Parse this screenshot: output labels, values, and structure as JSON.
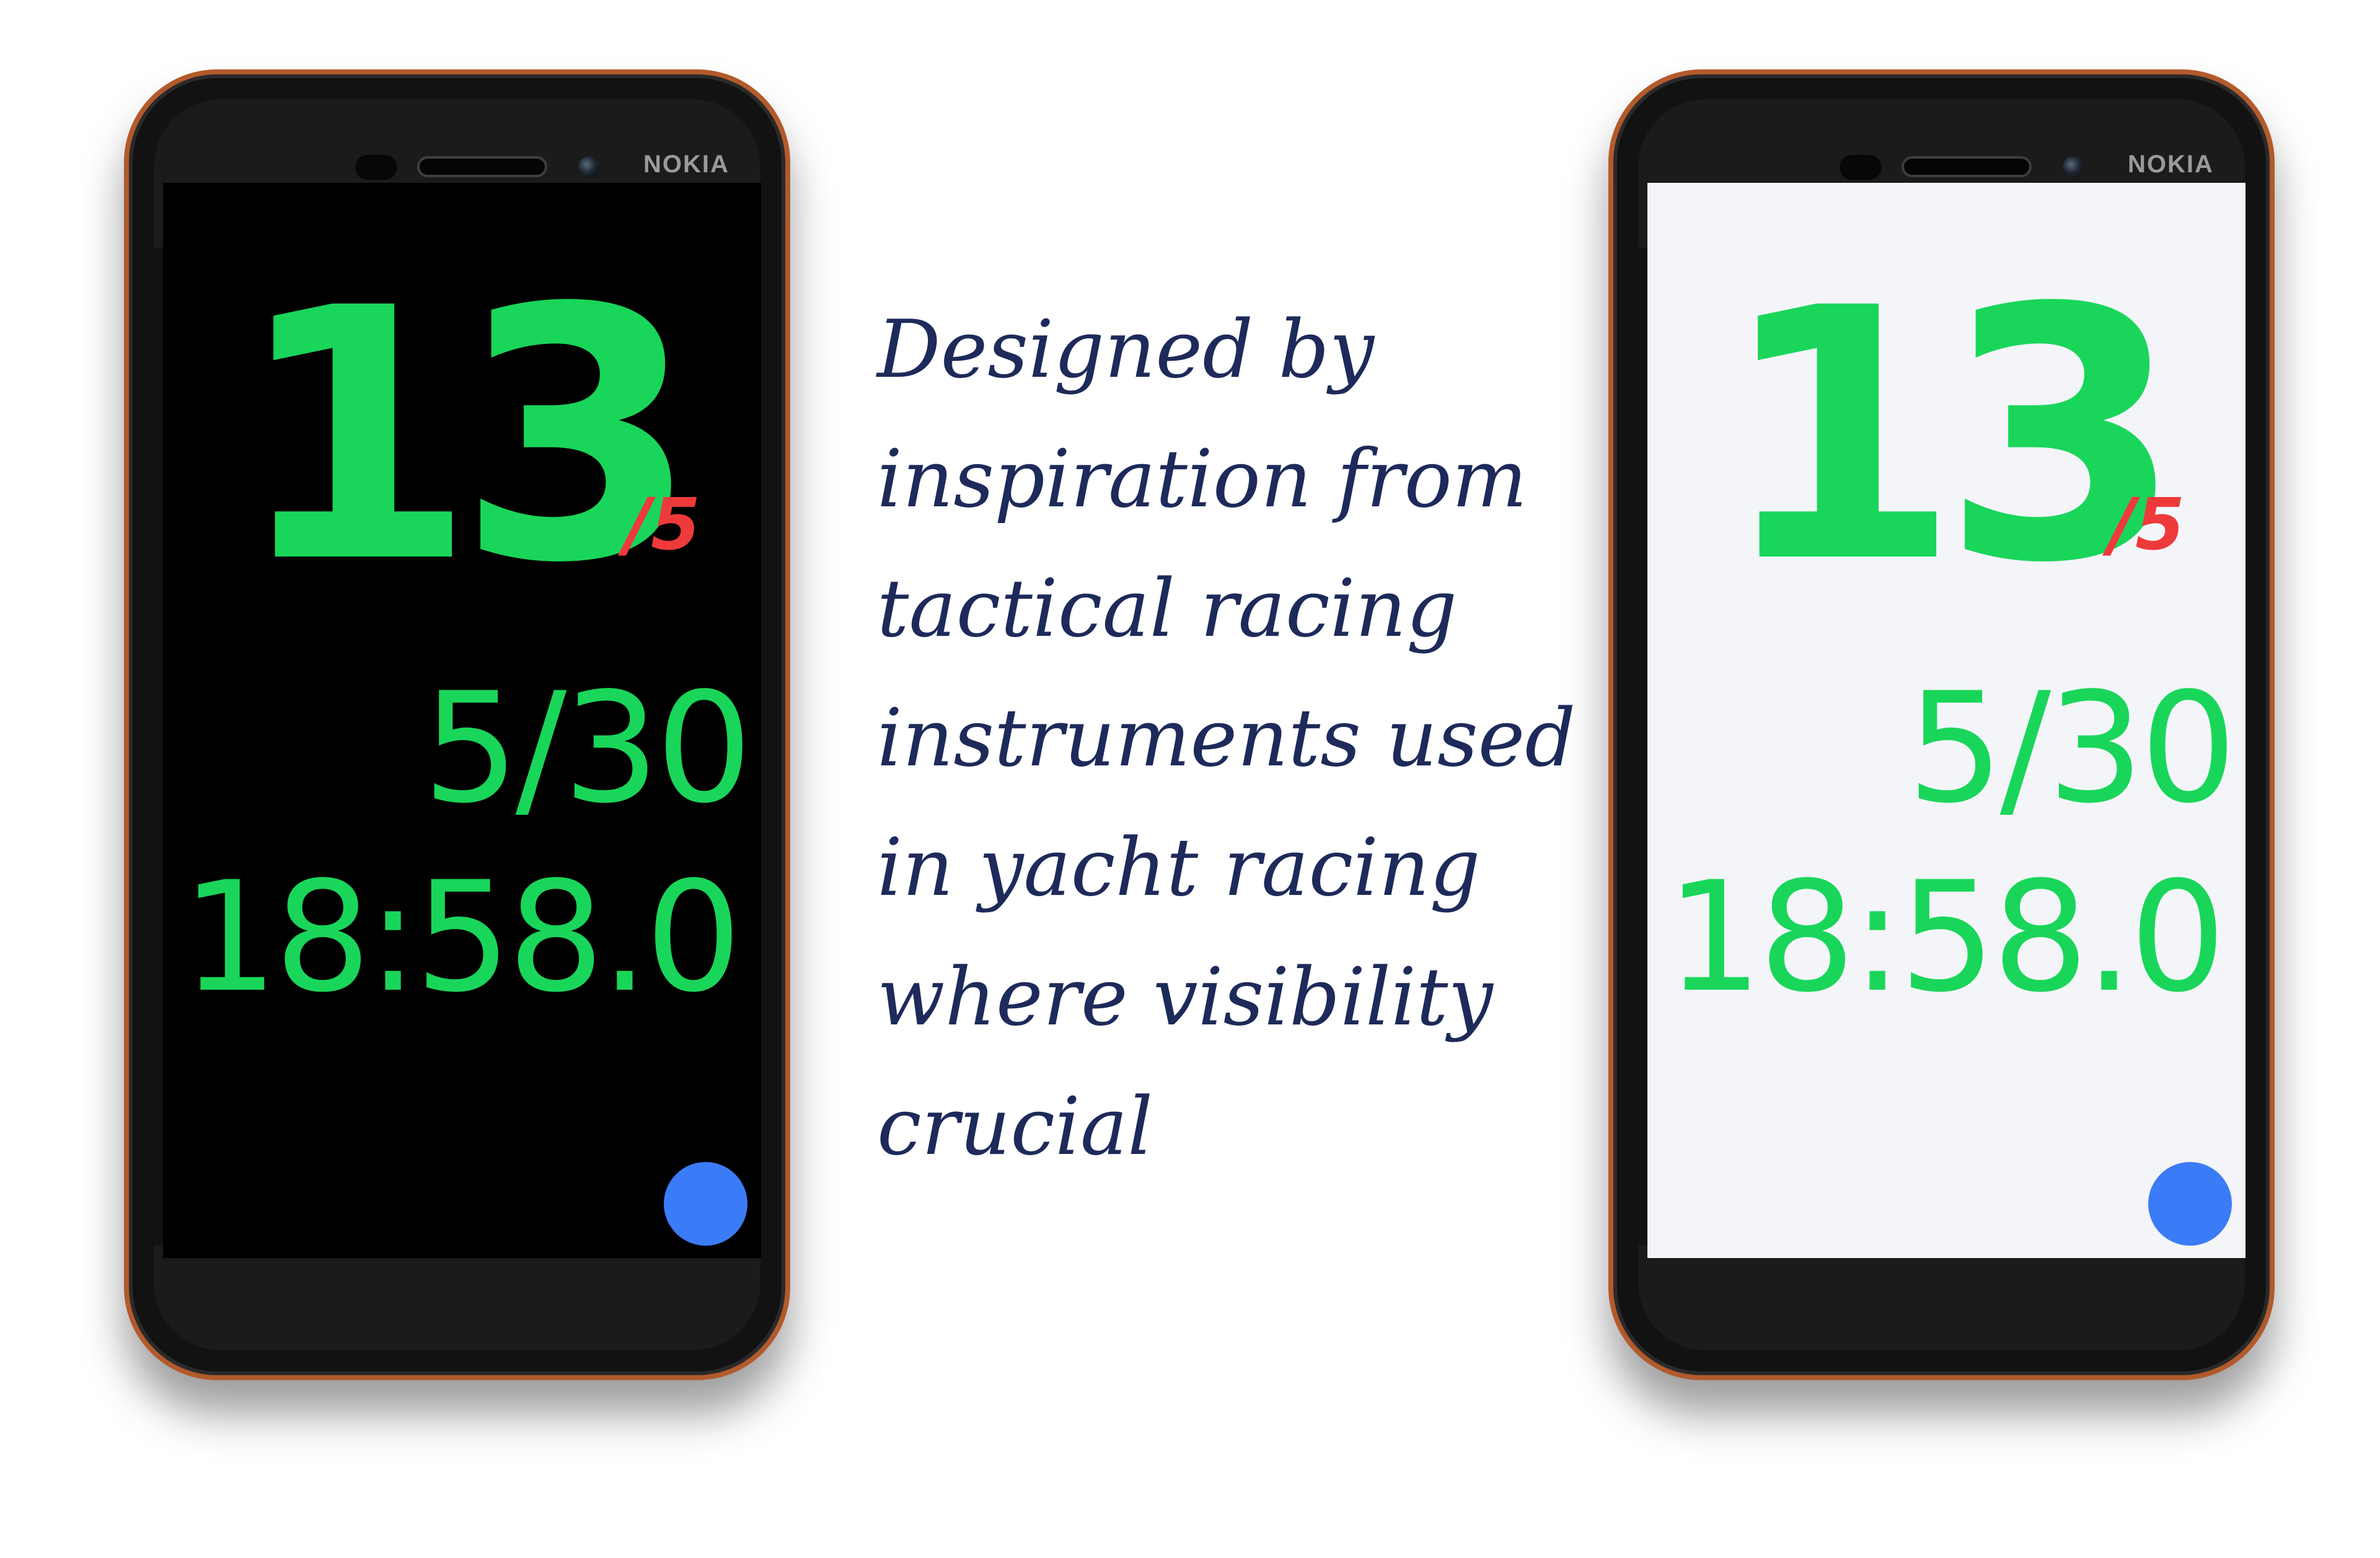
{
  "brand": "NOKIA",
  "tagline": {
    "lines": [
      "Designed by",
      "inspiration from",
      "tactical racing",
      "instruments used",
      "in yacht racing",
      "where visibility",
      "crucial"
    ]
  },
  "instrument": {
    "main_value": "13",
    "main_suffix": "/5",
    "count": "5/30",
    "timer": "18:58.0"
  },
  "themes": {
    "dark_screen_bg": "#000000",
    "light_screen_bg": "#f4f5f9",
    "primary_green": "#19d65a",
    "accent_red": "#ee3a3a",
    "fab_blue": "#3b7bf7",
    "tagline_navy": "#1d2a5a"
  },
  "icons": {
    "fab": "circle-button"
  }
}
